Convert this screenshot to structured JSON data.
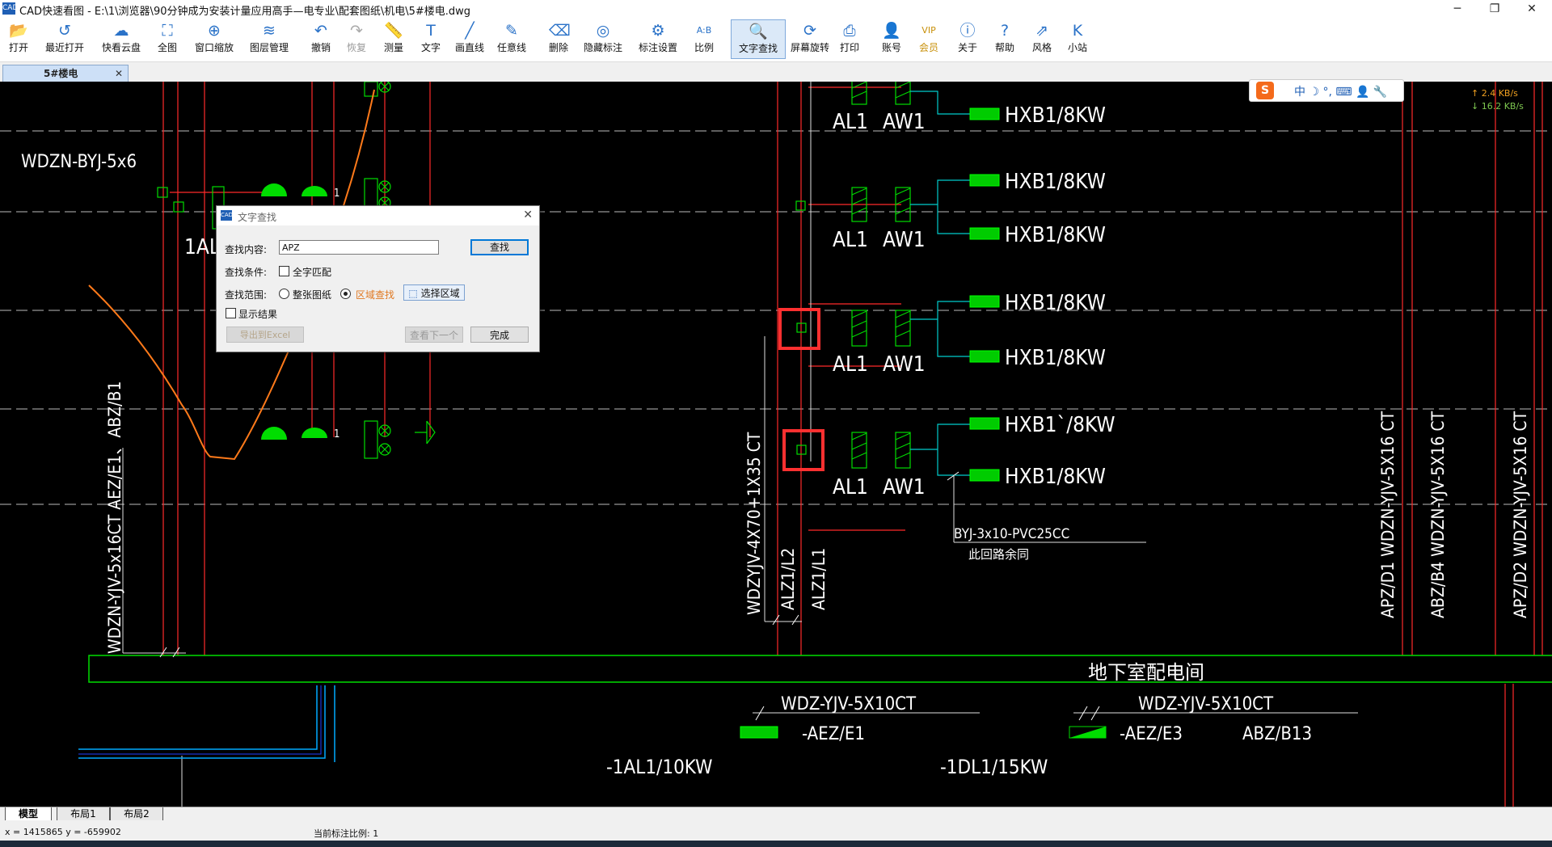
{
  "window": {
    "title": "CAD快速看图 - E:\\1\\浏览器\\90分钟成为安装计量应用高手—电专业\\配套图纸\\机电\\5#楼电.dwg",
    "minimize": "─",
    "maximize": "❐",
    "close": "✕"
  },
  "toolbar": {
    "items": [
      {
        "label": "打开",
        "icon": "folder-open-icon",
        "glyph": "📂"
      },
      {
        "label": "最近打开",
        "icon": "history-icon",
        "glyph": "↺"
      },
      {
        "label": "快看云盘",
        "icon": "cloud-icon",
        "glyph": "☁"
      },
      {
        "label": "全图",
        "icon": "fit-all-icon",
        "glyph": "⛶"
      },
      {
        "label": "窗口缩放",
        "icon": "window-zoom-icon",
        "glyph": "⊕"
      },
      {
        "label": "图层管理",
        "icon": "layers-icon",
        "glyph": "≋"
      },
      {
        "label": "撤销",
        "icon": "undo-icon",
        "glyph": "↶"
      },
      {
        "label": "恢复",
        "icon": "redo-icon",
        "glyph": "↷"
      },
      {
        "label": "测量",
        "icon": "measure-icon",
        "glyph": "📏"
      },
      {
        "label": "文字",
        "icon": "text-icon",
        "glyph": "T"
      },
      {
        "label": "画直线",
        "icon": "line-icon",
        "glyph": "╱"
      },
      {
        "label": "任意线",
        "icon": "freehand-icon",
        "glyph": "✎"
      },
      {
        "label": "删除",
        "icon": "eraser-icon",
        "glyph": "⌫"
      },
      {
        "label": "隐藏标注",
        "icon": "hide-annotation-icon",
        "glyph": "◎"
      },
      {
        "label": "标注设置",
        "icon": "annotation-settings-icon",
        "glyph": "⚙"
      },
      {
        "label": "比例",
        "icon": "scale-icon",
        "glyph": "A:B"
      },
      {
        "label": "文字查找",
        "icon": "text-search-icon",
        "glyph": "🔍"
      },
      {
        "label": "屏幕旋转",
        "icon": "rotate-screen-icon",
        "glyph": "⟳"
      },
      {
        "label": "打印",
        "icon": "print-icon",
        "glyph": "⎙"
      },
      {
        "label": "账号",
        "icon": "account-icon",
        "glyph": "👤"
      },
      {
        "label": "会员",
        "icon": "vip-icon",
        "glyph": "VIP"
      },
      {
        "label": "关于",
        "icon": "about-icon",
        "glyph": "ⓘ"
      },
      {
        "label": "帮助",
        "icon": "help-icon",
        "glyph": "?"
      },
      {
        "label": "风格",
        "icon": "style-icon",
        "glyph": "⇗"
      },
      {
        "label": "小站",
        "icon": "station-icon",
        "glyph": "K"
      }
    ]
  },
  "doc_tab": {
    "label": "5#楼电",
    "close": "✕"
  },
  "ime": {
    "logo": "S",
    "items": "中 ☽ °, ⌨ 👤 🔧"
  },
  "net": {
    "up": "↑ 2.4 KB/s",
    "down": "↓ 16.2 KB/s"
  },
  "drawing": {
    "top_left_cable": "WDZN-BYJ-5x6",
    "panel_1al": "1AL",
    "al": "AL1",
    "aw": "AW1",
    "hxb": "HXB1/8KW",
    "hxb_alt": "HXB1`/8KW",
    "riser_left": "WDZN-YJV-5x16CT  AEZ/E1、ABZ/B1",
    "riser_mid": "WDZYJV-4X70+1X35 CT",
    "riser_l2": "ALZ1/L2",
    "riser_l1": "ALZ1/L1",
    "branch_cable": "BYJ-3x10-PVC25CC",
    "branch_note": "此回路余同",
    "riser_right1": "APZ/D1 WDZN-YJV-5X16 CT",
    "riser_right2": "ABZ/B4  WDZN-YJV-5X16 CT",
    "riser_right3": "APZ/D2  WDZN-YJV-5X16 CT",
    "room": "地下室配电间",
    "feeder1": "WDZ-YJV-5X10CT",
    "feeder2": "WDZ-YJV-5X10CT",
    "aez_e1": "-AEZ/E1",
    "aez_e3": "-AEZ/E3",
    "abz_b13": "ABZ/B13",
    "al_10kw": "-1AL1/10KW",
    "dl_15kw": "-1DL1/15KW",
    "light_tag": "1"
  },
  "dialog": {
    "title": "文字查找",
    "close": "✕",
    "search_label": "查找内容:",
    "search_value": "APZ",
    "find_button": "查找",
    "condition_label": "查找条件:",
    "full_match": "全字匹配",
    "range_label": "查找范围:",
    "whole_drawing": "整张图纸",
    "region_search": "区域查找",
    "select_region": "选择区域",
    "show_results": "显示结果",
    "export_excel": "导出到Excel",
    "view_next": "查看下一个",
    "done": "完成"
  },
  "layout_tabs": [
    "模型",
    "布局1",
    "布局2"
  ],
  "status": {
    "coords": "x = 1415865  y = -659902",
    "scale": "当前标注比例: 1"
  },
  "colors": {
    "red": "#ff2a2a",
    "green": "#00dd00",
    "cyan": "#00cccc",
    "orange": "#ff7a1a",
    "highlight": "#ff3030"
  }
}
